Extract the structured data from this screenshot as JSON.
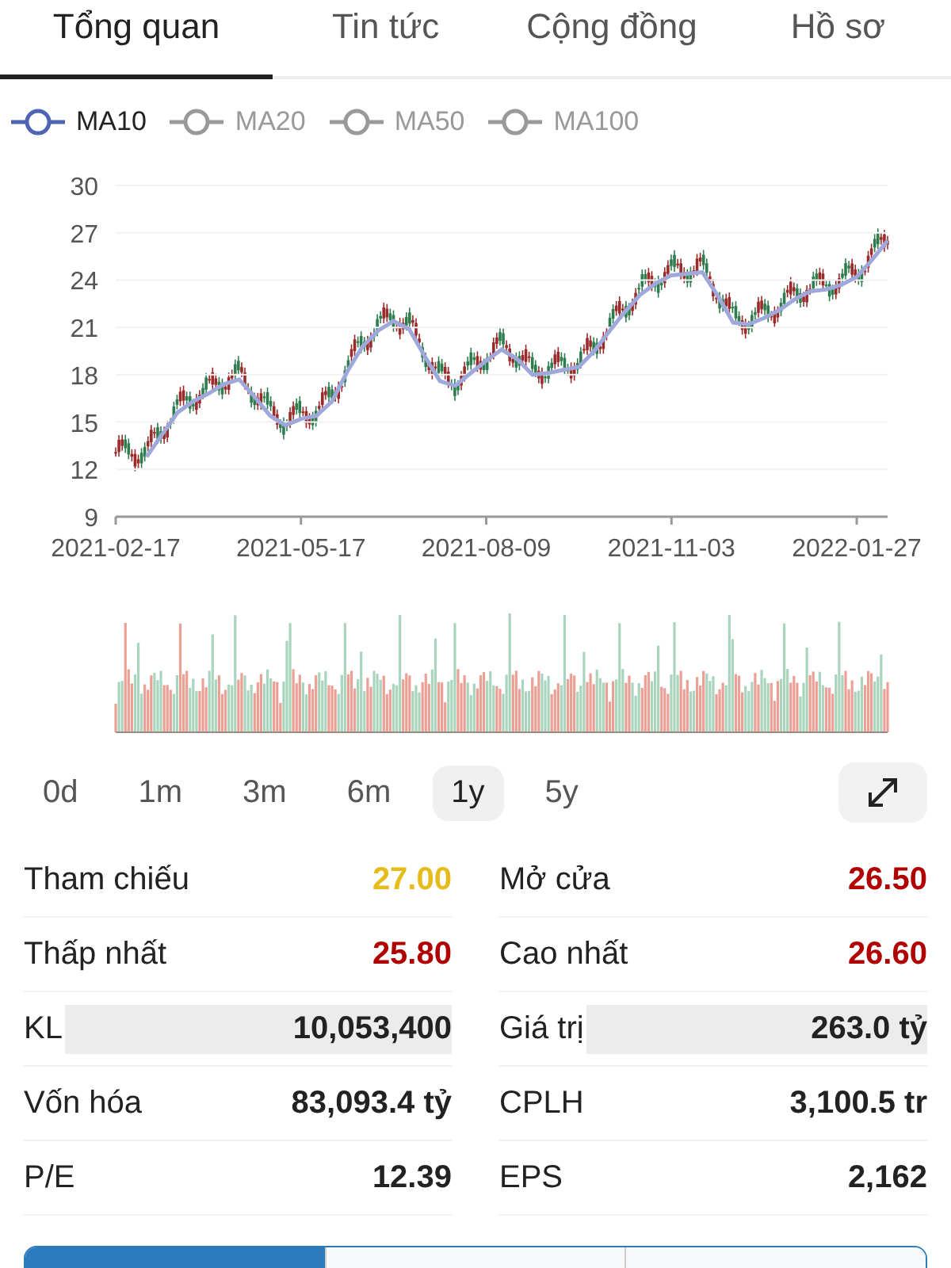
{
  "tabs": [
    {
      "label": "Tổng quan",
      "selected": true
    },
    {
      "label": "Tin tức",
      "selected": false
    },
    {
      "label": "Cộng đồng",
      "selected": false
    },
    {
      "label": "Hồ sơ",
      "selected": false
    }
  ],
  "legend": [
    {
      "label": "MA10",
      "on": true
    },
    {
      "label": "MA20",
      "on": false
    },
    {
      "label": "MA50",
      "on": false
    },
    {
      "label": "MA100",
      "on": false
    }
  ],
  "chart_data": {
    "type": "line",
    "categories": [
      "2021-02-17",
      null,
      null,
      null,
      null,
      null,
      null,
      null,
      null,
      null,
      null,
      null,
      "2021-05-17",
      null,
      null,
      null,
      null,
      null,
      null,
      null,
      null,
      null,
      null,
      null,
      "2021-08-09",
      null,
      null,
      null,
      null,
      null,
      null,
      null,
      null,
      null,
      null,
      null,
      "2021-11-03",
      null,
      null,
      null,
      null,
      null,
      null,
      null,
      null,
      null,
      null,
      null,
      "2022-01-27",
      null,
      null
    ],
    "series": [
      {
        "color": "#9fa8da",
        "values": [
          null,
          null,
          12.8,
          14.2,
          15.6,
          16.3,
          16.8,
          17.4,
          17.7,
          16.6,
          15.4,
          14.8,
          15.2,
          15.4,
          16.3,
          18.2,
          19.8,
          20.8,
          21.4,
          20.9,
          19.2,
          17.6,
          17.3,
          18.1,
          18.9,
          19.6,
          19.0,
          18.0,
          18.1,
          18.3,
          18.5,
          19.5,
          20.8,
          22.0,
          23.1,
          23.8,
          24.3,
          24.4,
          24.5,
          23.0,
          21.3,
          21.2,
          21.6,
          22.1,
          22.8,
          23.3,
          23.4,
          23.7,
          24.2,
          25.3,
          26.5
        ]
      }
    ],
    "ylim": [
      9,
      30
    ],
    "grid": true,
    "yticks": [
      9,
      12,
      15,
      18,
      21,
      24,
      27,
      30
    ]
  },
  "periods": [
    {
      "label": "0d",
      "selected": false
    },
    {
      "label": "1m",
      "selected": false
    },
    {
      "label": "3m",
      "selected": false
    },
    {
      "label": "6m",
      "selected": false
    },
    {
      "label": "1y",
      "selected": true
    },
    {
      "label": "5y",
      "selected": false
    }
  ],
  "stats": [
    {
      "label": "Tham chiếu",
      "value": "27.00",
      "color": "#e6bb1a",
      "highlighted": false
    },
    {
      "label": "Mở cửa",
      "value": "26.50",
      "color": "#b00000",
      "highlighted": false
    },
    {
      "label": "Thấp nhất",
      "value": "25.80",
      "color": "#b00000",
      "highlighted": false
    },
    {
      "label": "Cao nhất",
      "value": "26.60",
      "color": "#b00000",
      "highlighted": false
    },
    {
      "label": "KL",
      "value": "10,053,400",
      "color": "#222222",
      "highlighted": true
    },
    {
      "label": "Giá trị",
      "value": "263.0 tỷ",
      "color": "#222222",
      "highlighted": true
    },
    {
      "label": "Vốn hóa",
      "value": "83,093.4 tỷ",
      "color": "#222222",
      "highlighted": false
    },
    {
      "label": "CPLH",
      "value": "3,100.5 tr",
      "color": "#222222",
      "highlighted": false
    },
    {
      "label": "P/E",
      "value": "12.39",
      "color": "#222222",
      "highlighted": false
    },
    {
      "label": "EPS",
      "value": "2,162",
      "color": "#222222",
      "highlighted": false
    }
  ],
  "bottom_tabs": [
    {
      "selected": true
    },
    {
      "selected": false
    },
    {
      "selected": false
    }
  ]
}
